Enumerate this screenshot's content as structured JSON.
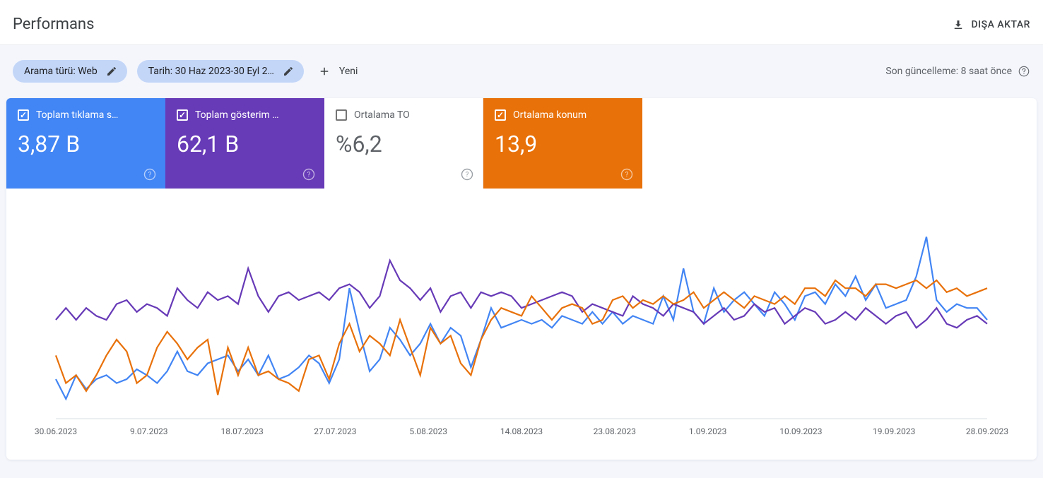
{
  "header": {
    "title": "Performans",
    "export_label": "DIŞA AKTAR"
  },
  "filters": {
    "search_type_chip": "Arama türü: Web",
    "date_chip": "Tarih: 30 Haz 2023-30 Eyl 2…",
    "add_new_label": "Yeni",
    "last_update_label": "Son güncelleme: 8 saat önce"
  },
  "metrics": {
    "clicks": {
      "label": "Toplam tıklama s…",
      "value": "3,87 B",
      "checked": true
    },
    "impressions": {
      "label": "Toplam gösterim …",
      "value": "62,1 B",
      "checked": true
    },
    "ctr": {
      "label": "Ortalama TO",
      "value": "%6,2",
      "checked": false
    },
    "position": {
      "label": "Ortalama konum",
      "value": "13,9",
      "checked": true
    }
  },
  "chart_data": {
    "type": "line",
    "title": "",
    "xlabel": "",
    "ylabel": "",
    "x_ticks": [
      "30.06.2023",
      "9.07.2023",
      "18.07.2023",
      "27.07.2023",
      "5.08.2023",
      "14.08.2023",
      "23.08.2023",
      "1.09.2023",
      "10.09.2023",
      "19.09.2023",
      "28.09.2023"
    ],
    "ylim_norm": [
      0,
      100
    ],
    "note": "Values below are normalised 0–100 from pixel readings of an unlabelled y-axis; higher = visually higher on the chart.",
    "series": [
      {
        "name": "Toplam tıklama sayısı",
        "color": "#4285f4",
        "values": [
          20,
          10,
          22,
          15,
          20,
          22,
          18,
          20,
          25,
          22,
          18,
          24,
          34,
          24,
          22,
          28,
          30,
          32,
          24,
          30,
          22,
          32,
          20,
          22,
          26,
          32,
          28,
          18,
          30,
          66,
          44,
          24,
          30,
          46,
          40,
          32,
          38,
          48,
          38,
          46,
          42,
          26,
          40,
          56,
          46,
          48,
          50,
          48,
          50,
          46,
          52,
          50,
          48,
          54,
          48,
          54,
          48,
          52,
          50,
          48,
          62,
          50,
          76,
          54,
          48,
          66,
          54,
          60,
          64,
          58,
          52,
          64,
          58,
          50,
          62,
          64,
          58,
          68,
          62,
          72,
          60,
          68,
          56,
          58,
          60,
          72,
          92,
          60,
          54,
          58,
          56,
          56,
          50
        ]
      },
      {
        "name": "Toplam gösterim sayısı",
        "color": "#673ab7",
        "values": [
          50,
          56,
          50,
          56,
          52,
          50,
          58,
          60,
          54,
          58,
          56,
          52,
          66,
          60,
          56,
          64,
          60,
          62,
          58,
          76,
          62,
          54,
          62,
          64,
          60,
          62,
          64,
          60,
          66,
          68,
          64,
          56,
          62,
          80,
          70,
          66,
          60,
          66,
          54,
          62,
          64,
          56,
          64,
          62,
          64,
          62,
          56,
          58,
          60,
          62,
          64,
          62,
          54,
          58,
          56,
          54,
          52,
          62,
          58,
          56,
          52,
          58,
          56,
          54,
          48,
          52,
          56,
          50,
          52,
          58,
          54,
          56,
          48,
          52,
          56,
          54,
          48,
          50,
          54,
          50,
          56,
          52,
          48,
          52,
          54,
          46,
          50,
          56,
          48,
          46,
          50,
          52,
          48
        ]
      },
      {
        "name": "Ortalama konum",
        "color": "#e8710a",
        "values": [
          32,
          18,
          22,
          14,
          22,
          32,
          40,
          34,
          18,
          22,
          36,
          44,
          38,
          30,
          36,
          40,
          12,
          36,
          22,
          36,
          22,
          24,
          20,
          18,
          14,
          30,
          32,
          20,
          38,
          48,
          34,
          42,
          38,
          32,
          50,
          36,
          22,
          46,
          38,
          42,
          28,
          22,
          40,
          50,
          56,
          54,
          52,
          62,
          56,
          50,
          56,
          58,
          56,
          48,
          50,
          60,
          62,
          56,
          60,
          58,
          62,
          58,
          60,
          64,
          56,
          60,
          64,
          60,
          56,
          62,
          60,
          58,
          62,
          58,
          66,
          66,
          62,
          70,
          66,
          66,
          62,
          68,
          68,
          66,
          68,
          70,
          66,
          70,
          64,
          66,
          62,
          64,
          66
        ]
      }
    ]
  }
}
